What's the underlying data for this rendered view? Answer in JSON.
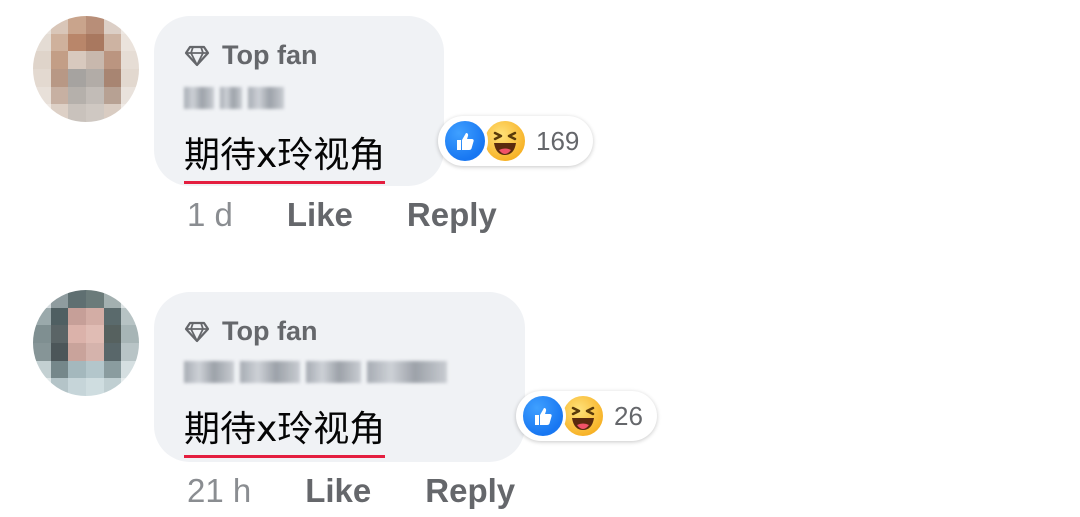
{
  "comments": [
    {
      "badge_label": "Top fan",
      "text": "期待x玲视角",
      "reaction_count": "169",
      "timestamp": "1 d",
      "like_label": "Like",
      "reply_label": "Reply"
    },
    {
      "badge_label": "Top fan",
      "text": "期待x玲视角",
      "reaction_count": "26",
      "timestamp": "21 h",
      "like_label": "Like",
      "reply_label": "Reply"
    }
  ],
  "colors": {
    "bubble": "#f0f2f5",
    "secondary_text": "#65676b",
    "like_blue": "#1877f2",
    "haha_yellow": "#f7b125",
    "underline_red": "#e41e3f"
  },
  "icons": {
    "badge": "diamond-icon",
    "reaction_1": "like-reaction-icon",
    "reaction_2": "haha-reaction-icon"
  }
}
